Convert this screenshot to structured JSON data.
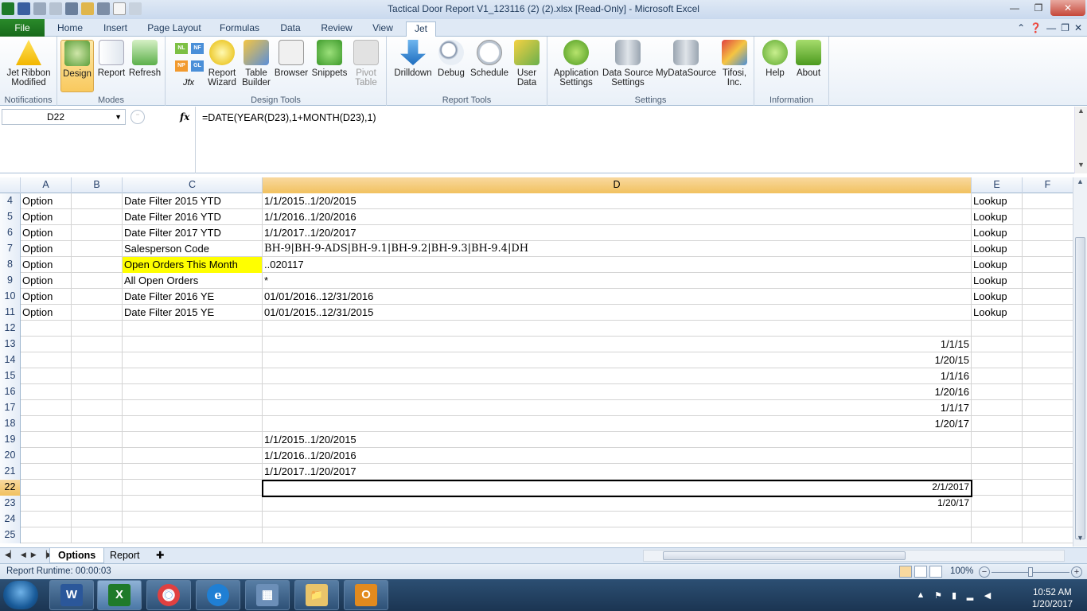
{
  "window": {
    "title": "Tactical Door Report V1_123116 (2) (2).xlsx  [Read-Only]  -  Microsoft Excel",
    "minimize": "—",
    "restore": "❐",
    "close": "✕"
  },
  "tabs": [
    "File",
    "Home",
    "Insert",
    "Page Layout",
    "Formulas",
    "Data",
    "Review",
    "View",
    "Jet"
  ],
  "active_tab": "Jet",
  "ribbon": {
    "groups": {
      "notifications": "Notifications",
      "modes": "Modes",
      "design_tools": "Design Tools",
      "report_tools": "Report Tools",
      "settings": "Settings",
      "information": "Information"
    },
    "buttons": {
      "jet_ribbon_modified": "Jet Ribbon\nModified",
      "design": "Design",
      "report": "Report",
      "refresh": "Refresh",
      "nl": "NL",
      "nf": "NF",
      "np": "NP",
      "gl": "GL",
      "jfx": "Jfx",
      "report_wizard": "Report\nWizard",
      "table_builder": "Table\nBuilder",
      "browser": "Browser",
      "snippets": "Snippets",
      "pivot_table": "Pivot\nTable",
      "drilldown": "Drilldown",
      "debug": "Debug",
      "schedule": "Schedule",
      "user_data": "User\nData",
      "application_settings": "Application\nSettings",
      "data_source_settings": "Data Source\nSettings",
      "mydatasource": "MyDataSource",
      "tifosi_inc": "Tifosi,\nInc.",
      "help": "Help",
      "about": "About"
    }
  },
  "formula_bar": {
    "name_box": "D22",
    "fx": "fx",
    "formula": "=DATE(YEAR(D23),1+MONTH(D23),1)"
  },
  "columns": [
    "A",
    "B",
    "C",
    "D",
    "E",
    "F"
  ],
  "selected_column": "D",
  "rows": [
    {
      "num": "4",
      "a": "Option",
      "c": "Date Filter 2015 YTD",
      "d": "1/1/2015..1/20/2015",
      "e": "Lookup"
    },
    {
      "num": "5",
      "a": "Option",
      "c": "Date Filter 2016 YTD",
      "d": "1/1/2016..1/20/2016",
      "e": "Lookup"
    },
    {
      "num": "6",
      "a": "Option",
      "c": "Date Filter 2017 YTD",
      "d": "1/1/2017..1/20/2017",
      "e": "Lookup"
    },
    {
      "num": "7",
      "a": "Option",
      "c": "Salesperson Code",
      "d": "BH-9|BH-9-ADS|BH-9.1|BH-9.2|BH-9.3|BH-9.4|DH",
      "e": "Lookup"
    },
    {
      "num": "8",
      "a": "Option",
      "c": "Open Orders This Month",
      "d": "..020117",
      "e": "Lookup"
    },
    {
      "num": "9",
      "a": "Option",
      "c": "All Open Orders",
      "d": "*",
      "e": "Lookup"
    },
    {
      "num": "10",
      "a": "Option",
      "c": "Date Filter 2016 YE",
      "d": "01/01/2016..12/31/2016",
      "e": "Lookup"
    },
    {
      "num": "11",
      "a": "Option",
      "c": "Date Filter 2015 YE",
      "d": "01/01/2015..12/31/2015",
      "e": "Lookup"
    },
    {
      "num": "12",
      "a": "",
      "c": "",
      "d": "",
      "e": ""
    },
    {
      "num": "13",
      "a": "",
      "c": "",
      "d": "1/1/15",
      "e": ""
    },
    {
      "num": "14",
      "a": "",
      "c": "",
      "d": "1/20/15",
      "e": ""
    },
    {
      "num": "15",
      "a": "",
      "c": "",
      "d": "1/1/16",
      "e": ""
    },
    {
      "num": "16",
      "a": "",
      "c": "",
      "d": "1/20/16",
      "e": ""
    },
    {
      "num": "17",
      "a": "",
      "c": "",
      "d": "1/1/17",
      "e": ""
    },
    {
      "num": "18",
      "a": "",
      "c": "",
      "d": "1/20/17",
      "e": ""
    },
    {
      "num": "19",
      "a": "",
      "c": "",
      "d": "1/1/2015..1/20/2015",
      "e": ""
    },
    {
      "num": "20",
      "a": "",
      "c": "",
      "d": "1/1/2016..1/20/2016",
      "e": ""
    },
    {
      "num": "21",
      "a": "",
      "c": "",
      "d": "1/1/2017..1/20/2017",
      "e": ""
    },
    {
      "num": "22",
      "a": "",
      "c": "",
      "d": "2/1/2017",
      "e": ""
    },
    {
      "num": "23",
      "a": "",
      "c": "",
      "d": "1/20/17",
      "e": ""
    },
    {
      "num": "24",
      "a": "",
      "c": "",
      "d": "",
      "e": ""
    },
    {
      "num": "25",
      "a": "",
      "c": "",
      "d": "",
      "e": ""
    }
  ],
  "sheets": [
    "Options",
    "Report"
  ],
  "active_sheet": "Options",
  "status": {
    "text": "Report Runtime:  00:00:03",
    "zoom": "100%",
    "zoom_minus": "−",
    "zoom_plus": "+"
  },
  "taskbar": {
    "apps": [
      "W",
      "X",
      "◉",
      "e",
      "▦",
      "📁",
      "O"
    ],
    "time": "10:52 AM",
    "date": "1/20/2017"
  },
  "colors": {
    "jet_tab_green": "#17691a",
    "highlight_yellow": "#ffff00",
    "selected_header": "#f1c15f"
  }
}
